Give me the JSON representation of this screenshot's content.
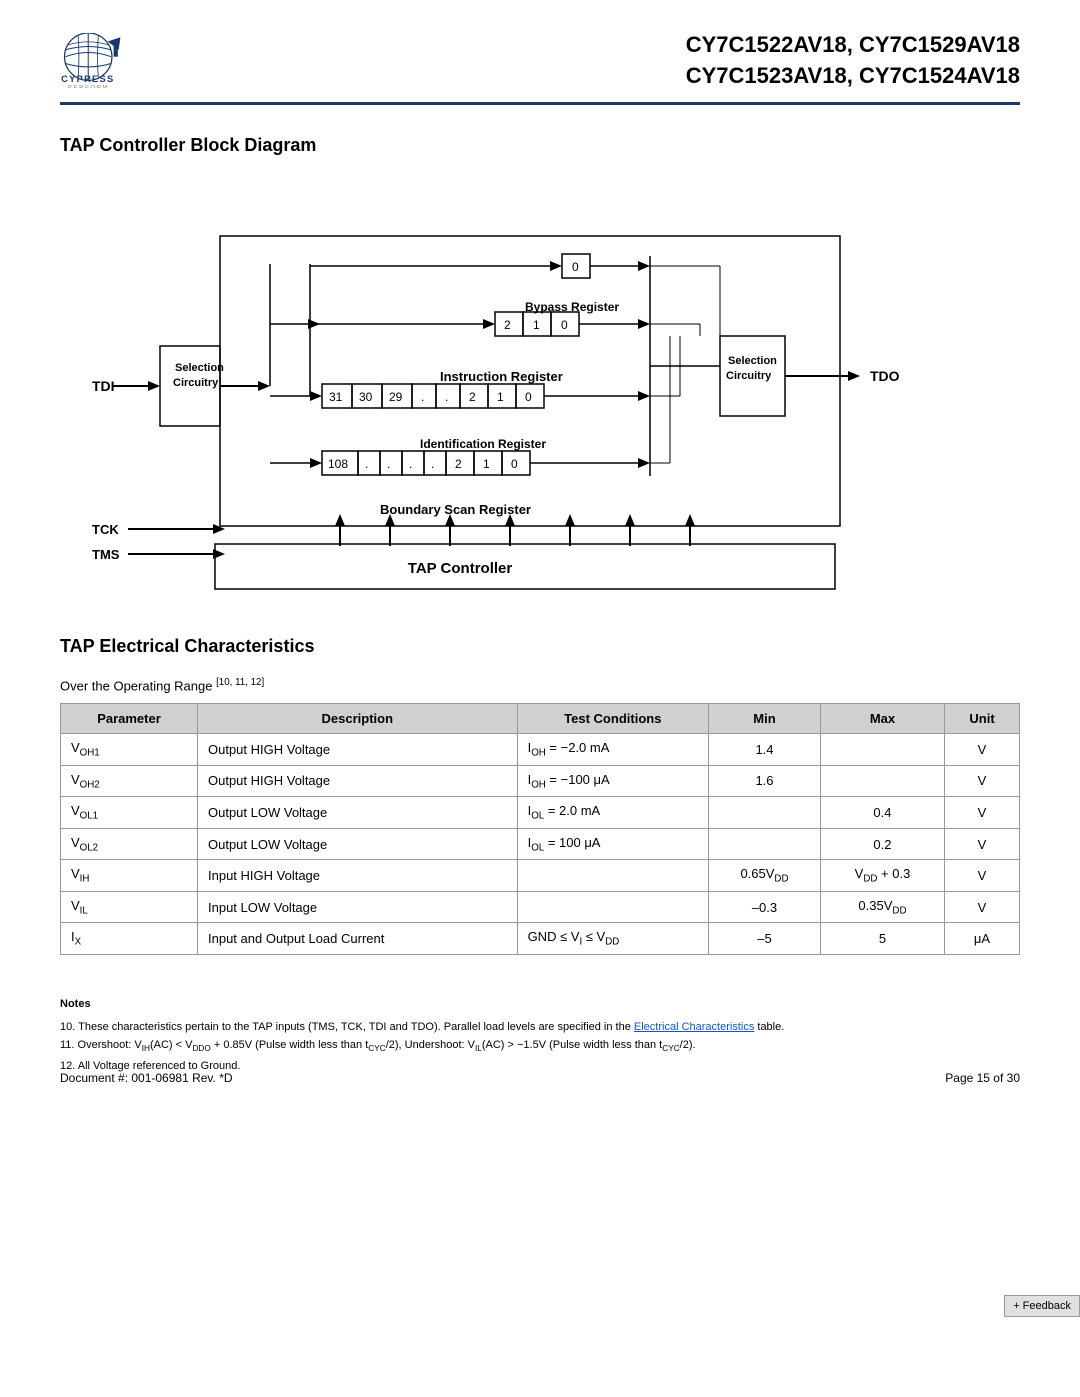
{
  "header": {
    "chip_title_line1": "CY7C1522AV18, CY7C1529AV18",
    "chip_title_line2": "CY7C1523AV18, CY7C1524AV18",
    "logo_company": "CYPRESS",
    "logo_tagline": "PERFORM"
  },
  "block_diagram": {
    "title": "TAP Controller Block Diagram",
    "labels": {
      "tdi": "TDI",
      "tdo": "TDO",
      "tck": "TCK",
      "tms": "TMS",
      "selection_circuitry_left": "Selection Circuitry",
      "selection_circuitry_right": "Selection Circuitry",
      "bypass_register": "Bypass Register",
      "instruction_register": "Instruction Register",
      "identification_register": "Identification Register",
      "boundary_scan_register": "Boundary Scan Register",
      "tap_controller": "TAP Controller"
    }
  },
  "tap_electrical": {
    "title": "TAP Electrical Characteristics",
    "subtitle": "Over the Operating Range [10, 11, 12]",
    "table_headers": [
      "Parameter",
      "Description",
      "Test Conditions",
      "Min",
      "Max",
      "Unit"
    ],
    "rows": [
      {
        "param": "V₀H1",
        "param_raw": "V_OH1",
        "description": "Output HIGH Voltage",
        "test_condition": "I₀H = −2.0 mA",
        "min": "1.4",
        "max": "",
        "unit": "V"
      },
      {
        "param": "V₀H2",
        "param_raw": "V_OH2",
        "description": "Output HIGH Voltage",
        "test_condition": "I₀H = −100 μA",
        "min": "1.6",
        "max": "",
        "unit": "V"
      },
      {
        "param": "V₀L1",
        "param_raw": "V_OL1",
        "description": "Output LOW Voltage",
        "test_condition": "I₀L = 2.0 mA",
        "min": "",
        "max": "0.4",
        "unit": "V"
      },
      {
        "param": "V₀L2",
        "param_raw": "V_OL2",
        "description": "Output LOW Voltage",
        "test_condition": "I₀L = 100 μA",
        "min": "",
        "max": "0.2",
        "unit": "V"
      },
      {
        "param": "V_IH",
        "param_raw": "V_IH",
        "description": "Input HIGH Voltage",
        "test_condition": "",
        "min": "0.65V_DD",
        "max": "V_DD + 0.3",
        "unit": "V"
      },
      {
        "param": "V_IL",
        "param_raw": "V_IL",
        "description": "Input LOW Voltage",
        "test_condition": "",
        "min": "−0.3",
        "max": "0.35V_DD",
        "unit": "V"
      },
      {
        "param": "I_X",
        "param_raw": "I_X",
        "description": "Input and Output Load Current",
        "test_condition": "GND ≤ V_I ≤ V_DD",
        "min": "−5",
        "max": "5",
        "unit": "μA"
      }
    ]
  },
  "notes": {
    "title": "Notes",
    "items": [
      "10. These characteristics pertain to the TAP inputs (TMS, TCK, TDI and TDO). Parallel load levels are specified in the Electrical Characteristics table.",
      "11. Overshoot: VᴵH(AC) < V_DDO + 0.85V (Pulse width less than t_CYC/2), Undershoot: VᴵL(AC) > −1.5V (Pulse width less than t_CYC/2).",
      "12. All Voltage referenced to Ground."
    ]
  },
  "footer": {
    "document": "Document #: 001-06981 Rev. *D",
    "page": "Page 15 of 30"
  },
  "feedback": "+ Feedback"
}
